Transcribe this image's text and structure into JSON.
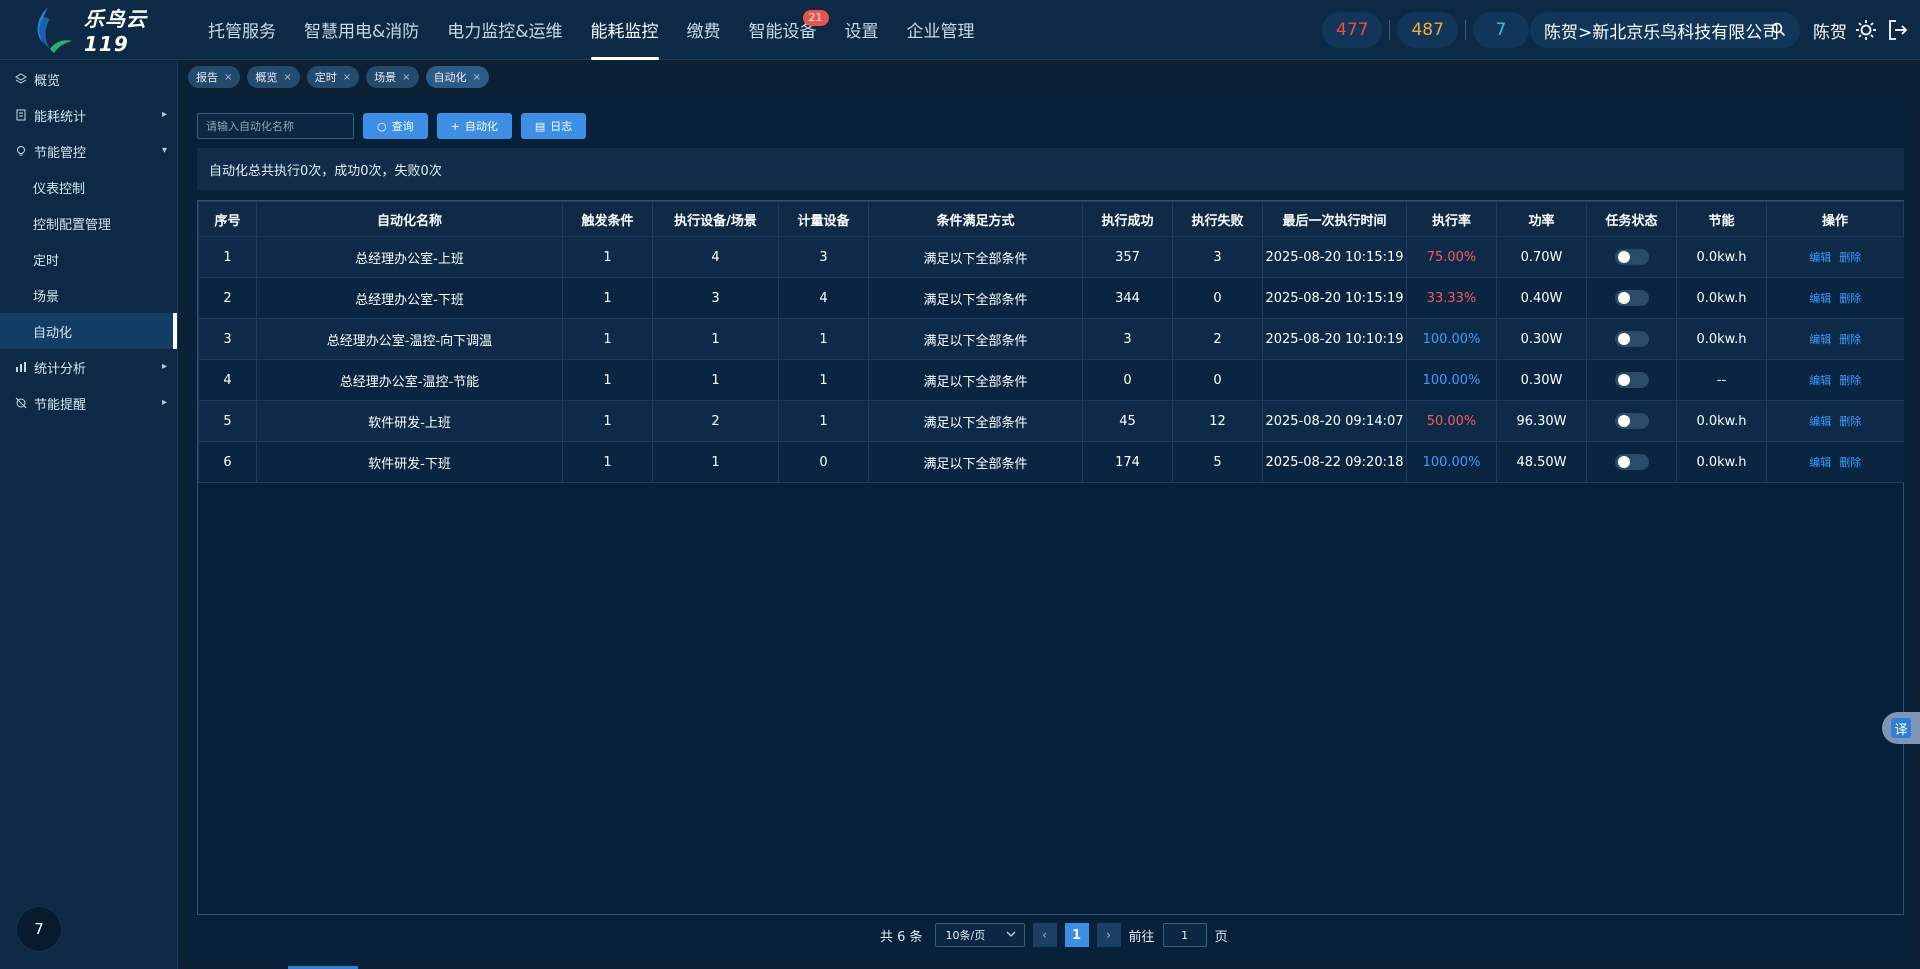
{
  "header": {
    "logo_text": "乐鸟云119",
    "nav": [
      {
        "label": "托管服务"
      },
      {
        "label": "智慧用电&消防"
      },
      {
        "label": "电力监控&运维"
      },
      {
        "label": "能耗监控",
        "active": true
      },
      {
        "label": "缴费"
      },
      {
        "label": "智能设备",
        "badge": "21"
      },
      {
        "label": "设置"
      },
      {
        "label": "企业管理"
      }
    ],
    "stats": [
      {
        "value": "477",
        "color": "#f04a4a"
      },
      {
        "value": "487",
        "color": "#f0a93e"
      },
      {
        "value": "7",
        "color": "#29c4e8"
      }
    ],
    "company": "陈贺>新北京乐鸟科技有限公司",
    "user_name": "陈贺"
  },
  "sidebar": {
    "items": [
      {
        "label": "概览",
        "icon": "layers-icon",
        "level": 1
      },
      {
        "label": "能耗统计",
        "icon": "report-icon",
        "level": 1,
        "arrow": "right"
      },
      {
        "label": "节能管控",
        "icon": "bulb-icon",
        "level": 1,
        "arrow": "down"
      },
      {
        "label": "仪表控制",
        "level": 2
      },
      {
        "label": "控制配置管理",
        "level": 2
      },
      {
        "label": "定时",
        "level": 2
      },
      {
        "label": "场景",
        "level": 2
      },
      {
        "label": "自动化",
        "level": 2,
        "active": true
      },
      {
        "label": "统计分析",
        "icon": "bar-chart-icon",
        "level": 1,
        "arrow": "right"
      },
      {
        "label": "节能提醒",
        "icon": "alert-icon",
        "level": 1,
        "arrow": "right"
      }
    ],
    "avatar_text": "7"
  },
  "tags": [
    {
      "label": "报告"
    },
    {
      "label": "概览"
    },
    {
      "label": "定时"
    },
    {
      "label": "场景"
    },
    {
      "label": "自动化",
      "active": true
    }
  ],
  "toolbar": {
    "search_placeholder": "请输入自动化名称",
    "query_label": "查询",
    "add_label": "自动化",
    "log_label": "日志"
  },
  "summary": "自动化总共执行0次，成功0次，失败0次",
  "table": {
    "columns": [
      "序号",
      "自动化名称",
      "触发条件",
      "执行设备/场景",
      "计量设备",
      "条件满足方式",
      "执行成功",
      "执行失败",
      "最后一次执行时间",
      "执行率",
      "功率",
      "任务状态",
      "节能",
      "操作"
    ],
    "rows": [
      {
        "no": "1",
        "name": "总经理办公室-上班",
        "trigger": "1",
        "exec": "4",
        "meter": "3",
        "mode": "满足以下全部条件",
        "success": "357",
        "fail": "3",
        "last": "2025-08-20 10:15:19",
        "rate": "75.00%",
        "rate_color": "red",
        "power": "0.70W",
        "energy": "0.0kw.h"
      },
      {
        "no": "2",
        "name": "总经理办公室-下班",
        "trigger": "1",
        "exec": "3",
        "meter": "4",
        "mode": "满足以下全部条件",
        "success": "344",
        "fail": "0",
        "last": "2025-08-20 10:15:19",
        "rate": "33.33%",
        "rate_color": "red",
        "power": "0.40W",
        "energy": "0.0kw.h"
      },
      {
        "no": "3",
        "name": "总经理办公室-温控-向下调温",
        "trigger": "1",
        "exec": "1",
        "meter": "1",
        "mode": "满足以下全部条件",
        "success": "3",
        "fail": "2",
        "last": "2025-08-20 10:10:19",
        "rate": "100.00%",
        "rate_color": "blue",
        "power": "0.30W",
        "energy": "0.0kw.h"
      },
      {
        "no": "4",
        "name": "总经理办公室-温控-节能",
        "trigger": "1",
        "exec": "1",
        "meter": "1",
        "mode": "满足以下全部条件",
        "success": "0",
        "fail": "0",
        "last": "",
        "rate": "100.00%",
        "rate_color": "blue",
        "power": "0.30W",
        "energy": "--"
      },
      {
        "no": "5",
        "name": "软件研发-上班",
        "trigger": "1",
        "exec": "2",
        "meter": "1",
        "mode": "满足以下全部条件",
        "success": "45",
        "fail": "12",
        "last": "2025-08-20 09:14:07",
        "rate": "50.00%",
        "rate_color": "red",
        "power": "96.30W",
        "energy": "0.0kw.h"
      },
      {
        "no": "6",
        "name": "软件研发-下班",
        "trigger": "1",
        "exec": "1",
        "meter": "0",
        "mode": "满足以下全部条件",
        "success": "174",
        "fail": "5",
        "last": "2025-08-22 09:20:18",
        "rate": "100.00%",
        "rate_color": "blue",
        "power": "48.50W",
        "energy": "0.0kw.h"
      }
    ],
    "edit_label": "编辑",
    "delete_label": "删除"
  },
  "pagination": {
    "total_text": "共 6 条",
    "page_size": "10条/页",
    "current_page": "1",
    "goto_label": "前往",
    "goto_value": "1",
    "page_suffix": "页"
  },
  "translate_label": "译"
}
